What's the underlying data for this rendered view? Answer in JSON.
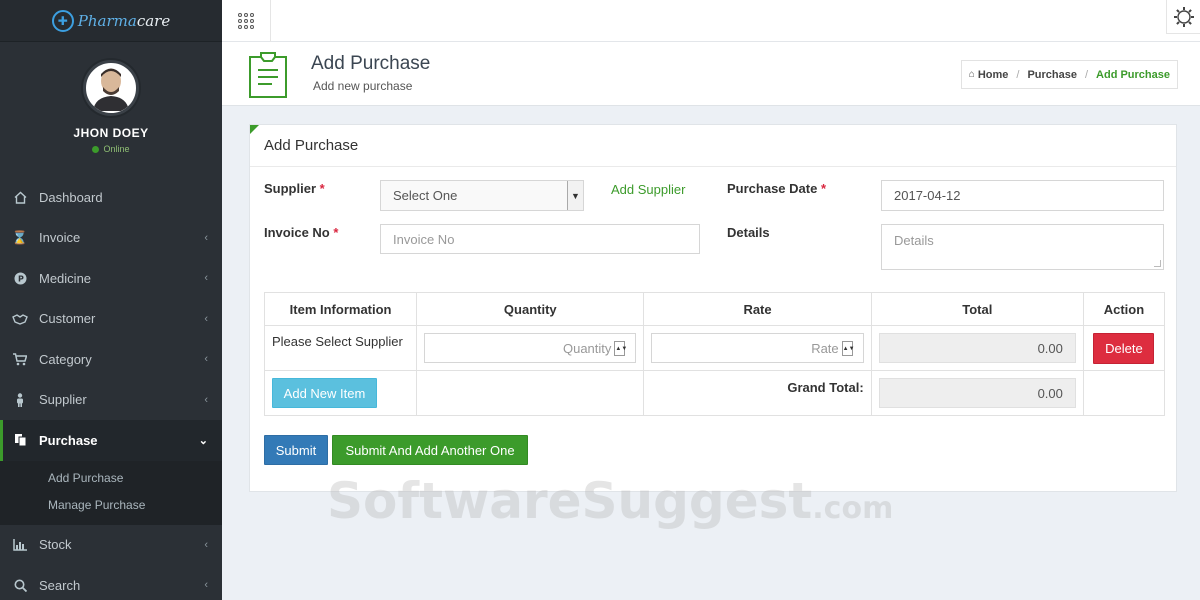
{
  "brand": {
    "name_part1": "Pharma",
    "name_part2": "care"
  },
  "user": {
    "name": "JHON DOEY",
    "status": "Online"
  },
  "sidebar": {
    "items": [
      {
        "label": "Dashboard",
        "icon": "home-icon"
      },
      {
        "label": "Invoice",
        "icon": "hourglass-icon"
      },
      {
        "label": "Medicine",
        "icon": "pill-icon"
      },
      {
        "label": "Customer",
        "icon": "handshake-icon"
      },
      {
        "label": "Category",
        "icon": "cart-icon"
      },
      {
        "label": "Supplier",
        "icon": "person-icon"
      },
      {
        "label": "Purchase",
        "icon": "copy-icon"
      },
      {
        "label": "Stock",
        "icon": "chart-icon"
      },
      {
        "label": "Search",
        "icon": "search-icon"
      }
    ],
    "submenu": [
      "Add Purchase",
      "Manage Purchase"
    ]
  },
  "header": {
    "title": "Add Purchase",
    "subtitle": "Add new purchase",
    "breadcrumb": [
      "Home",
      "Purchase",
      "Add Purchase"
    ]
  },
  "panel": {
    "title": "Add Purchase"
  },
  "form": {
    "supplier_label": "Supplier",
    "supplier_value": "Select One",
    "add_supplier_link": "Add Supplier",
    "purchase_date_label": "Purchase Date",
    "purchase_date_value": "2017-04-12",
    "invoice_label": "Invoice No",
    "invoice_placeholder": "Invoice No",
    "details_label": "Details",
    "details_placeholder": "Details",
    "required_mark": "*"
  },
  "table": {
    "headers": [
      "Item Information",
      "Quantity",
      "Rate",
      "Total",
      "Action"
    ],
    "row": {
      "item": "Please Select Supplier",
      "quantity_placeholder": "Quantity",
      "rate_placeholder": "Rate",
      "total": "0.00",
      "delete_label": "Delete"
    },
    "add_item_label": "Add New Item",
    "grand_total_label": "Grand Total:",
    "grand_total_value": "0.00"
  },
  "buttons": {
    "submit": "Submit",
    "submit_another": "Submit And Add Another One"
  },
  "watermark": {
    "main": "SoftwareSuggest",
    "suffix": ".com"
  },
  "colors": {
    "accent_green": "#3c9b2b",
    "sidebar_bg": "#2b3036",
    "delete_red": "#dd2d3f",
    "info_blue": "#5bc0de",
    "primary_blue": "#337ab7"
  }
}
